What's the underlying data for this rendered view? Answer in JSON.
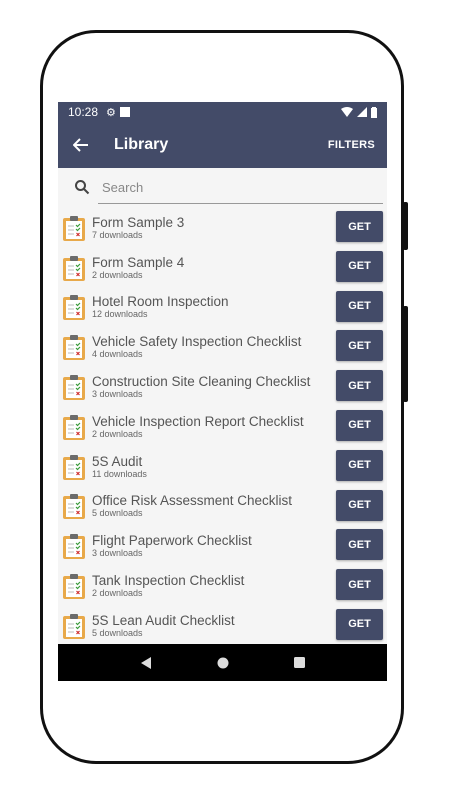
{
  "status": {
    "time": "10:28"
  },
  "appbar": {
    "title": "Library",
    "filters_label": "FILTERS"
  },
  "search": {
    "placeholder": "Search",
    "value": ""
  },
  "items": [
    {
      "name": "Form Sample 3",
      "downloads": "7 downloads",
      "button": "GET"
    },
    {
      "name": "Form Sample 4",
      "downloads": "2 downloads",
      "button": "GET"
    },
    {
      "name": "Hotel Room Inspection",
      "downloads": "12 downloads",
      "button": "GET"
    },
    {
      "name": "Vehicle Safety Inspection Checklist",
      "downloads": "4 downloads",
      "button": "GET"
    },
    {
      "name": "Construction Site Cleaning Checklist",
      "downloads": "3 downloads",
      "button": "GET"
    },
    {
      "name": "Vehicle Inspection Report Checklist",
      "downloads": "2 downloads",
      "button": "GET"
    },
    {
      "name": "5S Audit",
      "downloads": "11 downloads",
      "button": "GET"
    },
    {
      "name": "Office Risk Assessment Checklist",
      "downloads": "5 downloads",
      "button": "GET"
    },
    {
      "name": "Flight Paperwork Checklist",
      "downloads": "3 downloads",
      "button": "GET"
    },
    {
      "name": "Tank Inspection Checklist",
      "downloads": "2 downloads",
      "button": "GET"
    },
    {
      "name": "5S Lean Audit Checklist",
      "downloads": "5 downloads",
      "button": "GET"
    }
  ],
  "icons": {
    "back": "arrow-left-icon",
    "search": "search-icon",
    "item": "clipboard-icon"
  },
  "colors": {
    "primary": "#434b68",
    "clipboard": "#e8a94a"
  }
}
